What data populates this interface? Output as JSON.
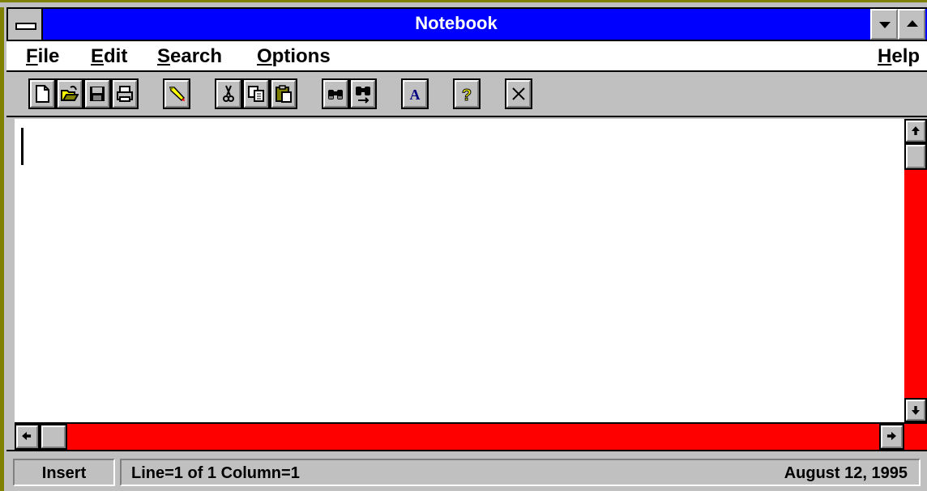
{
  "window": {
    "title": "Notebook"
  },
  "menubar": {
    "items": [
      {
        "label": "File",
        "accel": "F",
        "rest": "ile"
      },
      {
        "label": "Edit",
        "accel": "E",
        "rest": "dit"
      },
      {
        "label": "Search",
        "accel": "S",
        "rest": "earch"
      },
      {
        "label": "Options",
        "accel": "O",
        "rest": "ptions"
      },
      {
        "label": "Help",
        "accel": "H",
        "rest": "elp"
      }
    ]
  },
  "toolbar": {
    "buttons": [
      {
        "name": "new-file",
        "icon": "new-document-icon"
      },
      {
        "name": "open-file",
        "icon": "open-folder-icon"
      },
      {
        "name": "save",
        "icon": "floppy-disk-icon"
      },
      {
        "name": "print",
        "icon": "printer-icon"
      },
      {
        "name": "edit-pen",
        "icon": "pencil-icon"
      },
      {
        "name": "cut",
        "icon": "scissors-icon"
      },
      {
        "name": "copy",
        "icon": "copy-icon"
      },
      {
        "name": "paste",
        "icon": "clipboard-icon"
      },
      {
        "name": "find",
        "icon": "binoculars-icon"
      },
      {
        "name": "find-next",
        "icon": "binoculars-next-icon"
      },
      {
        "name": "font",
        "icon": "font-icon",
        "label": "A"
      },
      {
        "name": "help",
        "icon": "help-icon",
        "label": "?"
      },
      {
        "name": "exit",
        "icon": "close-x-icon"
      }
    ]
  },
  "statusbar": {
    "mode": "Insert",
    "position": "Line=1 of 1 Column=1",
    "date": "August 12, 1995"
  },
  "colors": {
    "title_bg": "#0000ff",
    "scroll_track": "#ff0000",
    "chrome": "#c0c0c0"
  }
}
